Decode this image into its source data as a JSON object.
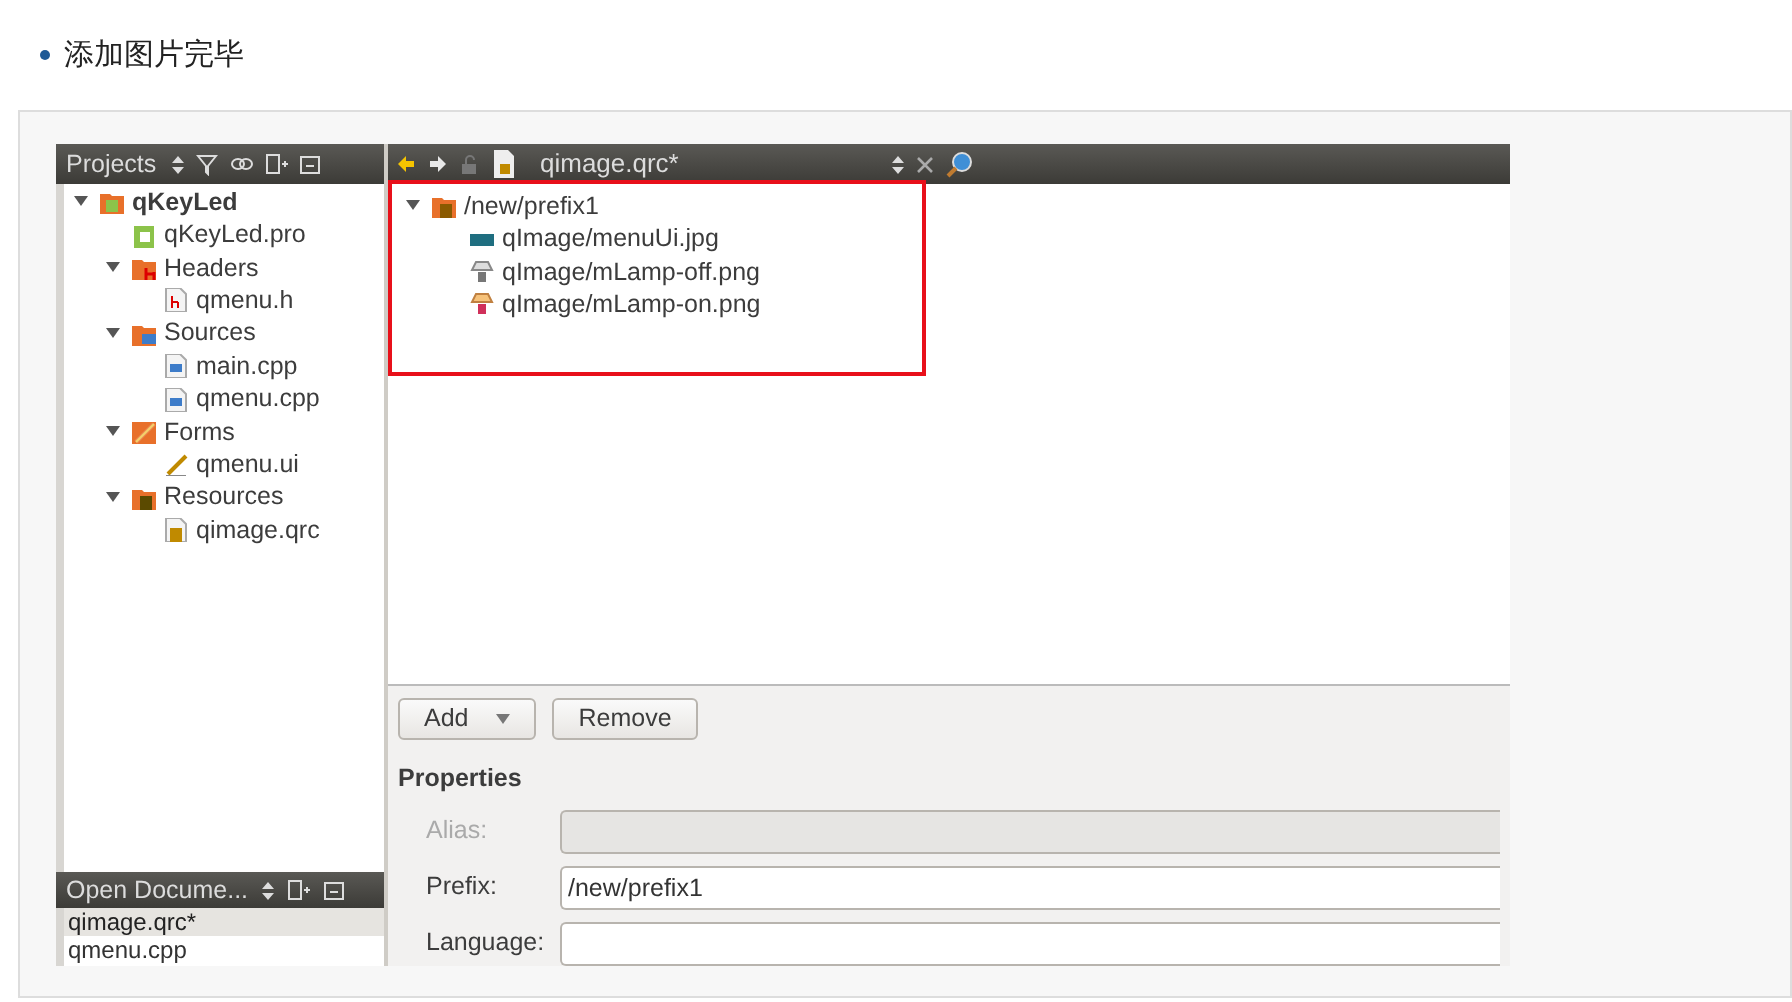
{
  "heading": {
    "text": "添加图片完毕"
  },
  "projects_panel": {
    "title": "Projects",
    "tree": [
      {
        "label": "qKeyLed",
        "kind": "project",
        "expanded": true,
        "children": [
          {
            "label": "qKeyLed.pro",
            "kind": "pro"
          },
          {
            "label": "Headers",
            "kind": "headers",
            "expanded": true,
            "children": [
              {
                "label": "qmenu.h",
                "kind": "h"
              }
            ]
          },
          {
            "label": "Sources",
            "kind": "sources",
            "expanded": true,
            "children": [
              {
                "label": "main.cpp",
                "kind": "cpp"
              },
              {
                "label": "qmenu.cpp",
                "kind": "cpp"
              }
            ]
          },
          {
            "label": "Forms",
            "kind": "forms",
            "expanded": true,
            "children": [
              {
                "label": "qmenu.ui",
                "kind": "ui"
              }
            ]
          },
          {
            "label": "Resources",
            "kind": "resources",
            "expanded": true,
            "children": [
              {
                "label": "qimage.qrc",
                "kind": "qrc"
              }
            ]
          }
        ]
      }
    ]
  },
  "open_documents": {
    "title": "Open Docume...",
    "items": [
      {
        "label": "qimage.qrc*",
        "selected": true
      },
      {
        "label": "qmenu.cpp",
        "selected": false
      }
    ]
  },
  "editor": {
    "file": "qimage.qrc*",
    "tree": [
      {
        "label": "/new/prefix1",
        "kind": "prefix",
        "expanded": true,
        "children": [
          {
            "label": "qImage/menuUi.jpg",
            "kind": "image"
          },
          {
            "label": "qImage/mLamp-off.png",
            "kind": "lamp_off"
          },
          {
            "label": "qImage/mLamp-on.png",
            "kind": "lamp_on"
          }
        ]
      }
    ]
  },
  "buttons": [
    {
      "label": "Add",
      "dropdown": true
    },
    {
      "label": "Remove",
      "dropdown": false
    }
  ],
  "properties": {
    "title": "Properties",
    "fields": [
      {
        "label": "Alias:",
        "disabled": true
      },
      {
        "label": "Prefix:",
        "value": "/new/prefix1",
        "disabled": false
      },
      {
        "label": "Language:",
        "disabled": false
      }
    ]
  }
}
